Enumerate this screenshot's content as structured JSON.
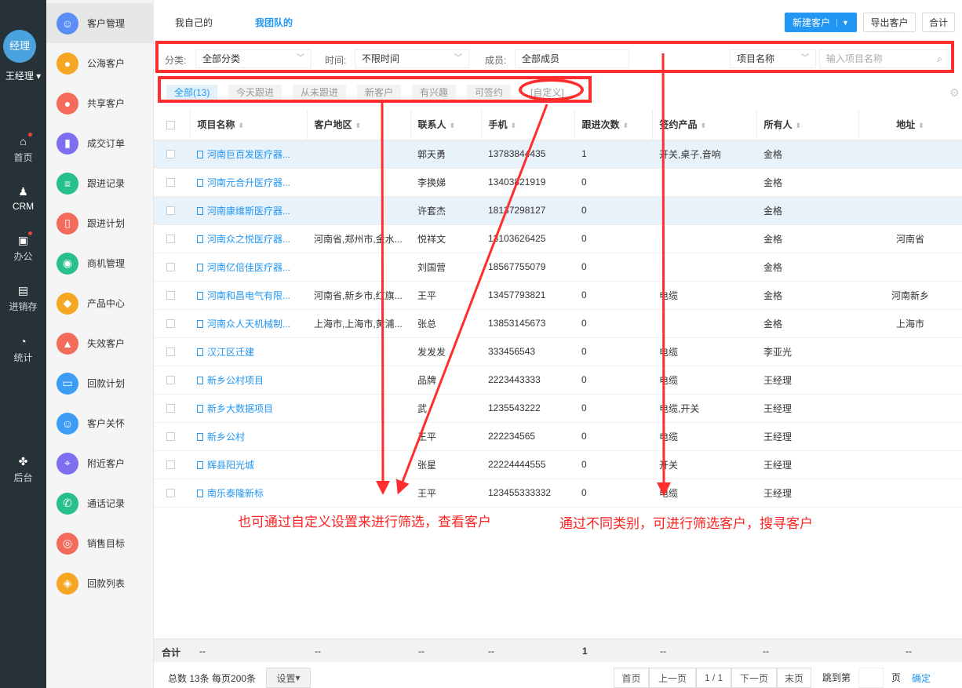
{
  "rail": {
    "avatar": "经理",
    "username": "王经理",
    "items": [
      {
        "label": "首页",
        "icon": "home-icon"
      },
      {
        "label": "CRM",
        "icon": "crm-icon"
      },
      {
        "label": "办公",
        "icon": "briefcase-icon"
      },
      {
        "label": "进销存",
        "icon": "warehouse-icon"
      },
      {
        "label": "统计",
        "icon": "pie-chart-icon"
      },
      {
        "label": "后台",
        "icon": "grid-icon"
      }
    ]
  },
  "sidebar": {
    "items": [
      {
        "label": "客户管理",
        "color": "#5c8df6"
      },
      {
        "label": "公海客户",
        "color": "#f5a623"
      },
      {
        "label": "共享客户",
        "color": "#f26b5b"
      },
      {
        "label": "成交订单",
        "color": "#7e6ef0"
      },
      {
        "label": "跟进记录",
        "color": "#27c08a"
      },
      {
        "label": "跟进计划",
        "color": "#f26b5b"
      },
      {
        "label": "商机管理",
        "color": "#27c08a"
      },
      {
        "label": "产品中心",
        "color": "#f5a623"
      },
      {
        "label": "失效客户",
        "color": "#f26b5b"
      },
      {
        "label": "回款计划",
        "color": "#3d9df5"
      },
      {
        "label": "客户关怀",
        "color": "#3d9df5"
      },
      {
        "label": "附近客户",
        "color": "#7e6ef0"
      },
      {
        "label": "通话记录",
        "color": "#27c08a"
      },
      {
        "label": "销售目标",
        "color": "#f26b5b"
      },
      {
        "label": "回款列表",
        "color": "#f5a623"
      }
    ]
  },
  "header": {
    "tabs": [
      "我自己的",
      "我团队的"
    ],
    "new_button": "新建客户",
    "export_button": "导出客户",
    "merge_button": "合计"
  },
  "filter": {
    "category_label": "分类:",
    "category_value": "全部分类",
    "time_label": "时间:",
    "time_value": "不限时间",
    "member_label": "成员:",
    "member_value": "全部成员",
    "search_field": "项目名称",
    "search_placeholder": "输入项目名称"
  },
  "quick_tabs": [
    "全部(13)",
    "今天跟进",
    "从未跟进",
    "新客户",
    "有兴趣",
    "可签约",
    "[自定义]"
  ],
  "table": {
    "columns": [
      "项目名称",
      "客户地区",
      "联系人",
      "手机",
      "跟进次数",
      "签约产品",
      "所有人",
      "地址"
    ],
    "rows": [
      [
        "河南巨百发医疗器...",
        "",
        "郭天勇",
        "13783844435",
        "1",
        "开关,桌子,音响",
        "金格",
        ""
      ],
      [
        "河南元合升医疗器...",
        "",
        "李换娣",
        "13403821919",
        "0",
        "",
        "金格",
        ""
      ],
      [
        "河南康维斯医疗器...",
        "",
        "许套杰",
        "18137298127",
        "0",
        "",
        "金格",
        ""
      ],
      [
        "河南众之悦医疗器...",
        "河南省,郑州市,金水...",
        "悦祥文",
        "13103626425",
        "0",
        "",
        "金格",
        "河南省"
      ],
      [
        "河南亿倍佳医疗器...",
        "",
        "刘国营",
        "18567755079",
        "0",
        "",
        "金格",
        ""
      ],
      [
        "河南和昌电气有限...",
        "河南省,新乡市,红旗...",
        "王平",
        "13457793821",
        "0",
        "电缆",
        "金格",
        "河南新乡"
      ],
      [
        "河南众人天机械制...",
        "上海市,上海市,黄浦...",
        "张总",
        "13853145673",
        "0",
        "",
        "金格",
        "上海市"
      ],
      [
        "汉江区迁建",
        "",
        "发发发",
        "333456543",
        "0",
        "电缆",
        "李亚光",
        ""
      ],
      [
        "新乡公村项目",
        "",
        "品牌",
        "2223443333",
        "0",
        "电缆",
        "王经理",
        ""
      ],
      [
        "新乡大数据项目",
        "",
        "武",
        "1235543222",
        "0",
        "电缆,开关",
        "王经理",
        ""
      ],
      [
        "新乡公村",
        "",
        "王平",
        "222234565",
        "0",
        "电缆",
        "王经理",
        ""
      ],
      [
        "辉县阳光城",
        "",
        "张星",
        "22224444555",
        "0",
        "开关",
        "王经理",
        ""
      ],
      [
        "南乐泰隆新标",
        "",
        "王平",
        "123455333332",
        "0",
        "电缆",
        "王经理",
        ""
      ]
    ],
    "highlighted_rows": [
      0,
      2
    ]
  },
  "summary": {
    "label": "合计",
    "values": [
      "--",
      "--",
      "--",
      "--",
      "1",
      "--",
      "--",
      "--"
    ]
  },
  "footer": {
    "total_text": "总数 13条 每页200条",
    "settings_button": "设置",
    "first": "首页",
    "prev": "上一页",
    "page": "1 / 1",
    "next": "下一页",
    "last": "末页",
    "jump_label": "跳到第",
    "page_unit": "页",
    "confirm": "确定"
  },
  "annotations": {
    "left": "也可通过自定义设置来进行筛选，查看客户",
    "right": "通过不同类别，可进行筛选客户，搜寻客户",
    "color": "#ff2d2d"
  }
}
